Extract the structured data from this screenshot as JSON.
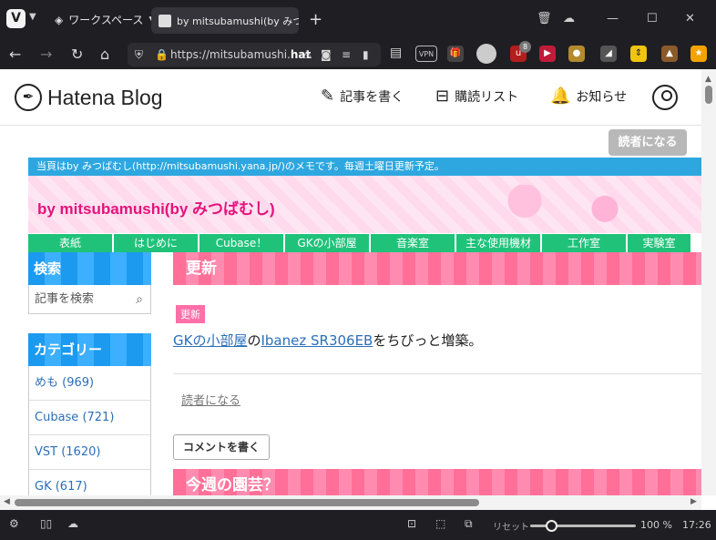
{
  "browser": {
    "logo": "V",
    "workspace": "ワークスペース",
    "tab_title": "by mitsubamushi(by みつばむし)",
    "url_prefix": "https://mitsubamushi.",
    "url_bold": "hat",
    "status_reset": "リセット",
    "zoom": "100 %",
    "clock": "17:26",
    "ext_badge": "8",
    "vpn": "VPN",
    "zoom_fraction": 0.15
  },
  "hatena": {
    "logo_text": "Hatena Blog",
    "nav_write": "記事を書く",
    "nav_subscriptions": "購読リスト",
    "nav_notifications": "お知らせ",
    "reader_button": "読者になる"
  },
  "blog": {
    "notice": "当頁はby みつばむし(http://mitsubamushi.yana.jp/)のメモです。毎週土曜日更新予定。",
    "title": "by mitsubamushi(by みつばむし)",
    "global_nav": [
      "表紙",
      "はじめに",
      "Cubase！",
      "GKの小部屋",
      "音楽室",
      "主な使用機材",
      "工作室",
      "実験室"
    ]
  },
  "sidebar": {
    "search_title": "検索",
    "search_placeholder": "記事を検索",
    "category_title": "カテゴリー",
    "categories": [
      "めも (969)",
      "Cubase (721)",
      "VST (1620)",
      "GK (617)"
    ]
  },
  "post": {
    "title": "更新",
    "tag": "更新",
    "link1": "GKの小部屋",
    "text1": "の",
    "link2": "Ibanez SR306EB",
    "text2": "をちびっと増築。",
    "subscribe": "読者になる",
    "comment_button": "コメントを書く",
    "next_title": "今週の園芸？"
  }
}
